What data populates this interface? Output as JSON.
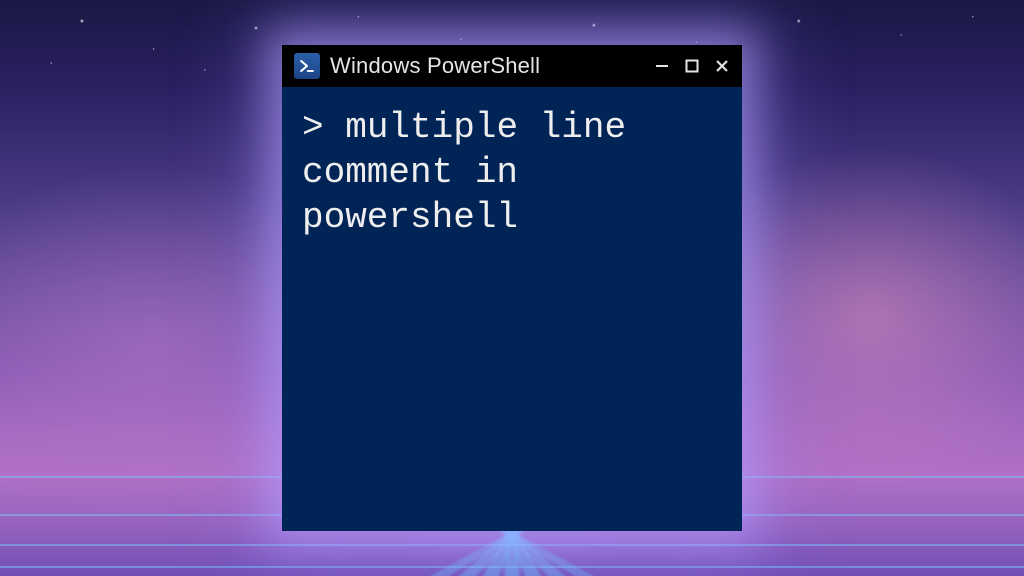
{
  "window": {
    "title": "Windows PowerShell"
  },
  "terminal": {
    "prompt": ">",
    "command": "multiple line comment in powershell"
  },
  "controls": {
    "minimize": "−",
    "maximize": "☐",
    "close": "✕"
  },
  "colors": {
    "terminal_bg": "#012456",
    "text": "#eeeeee"
  }
}
